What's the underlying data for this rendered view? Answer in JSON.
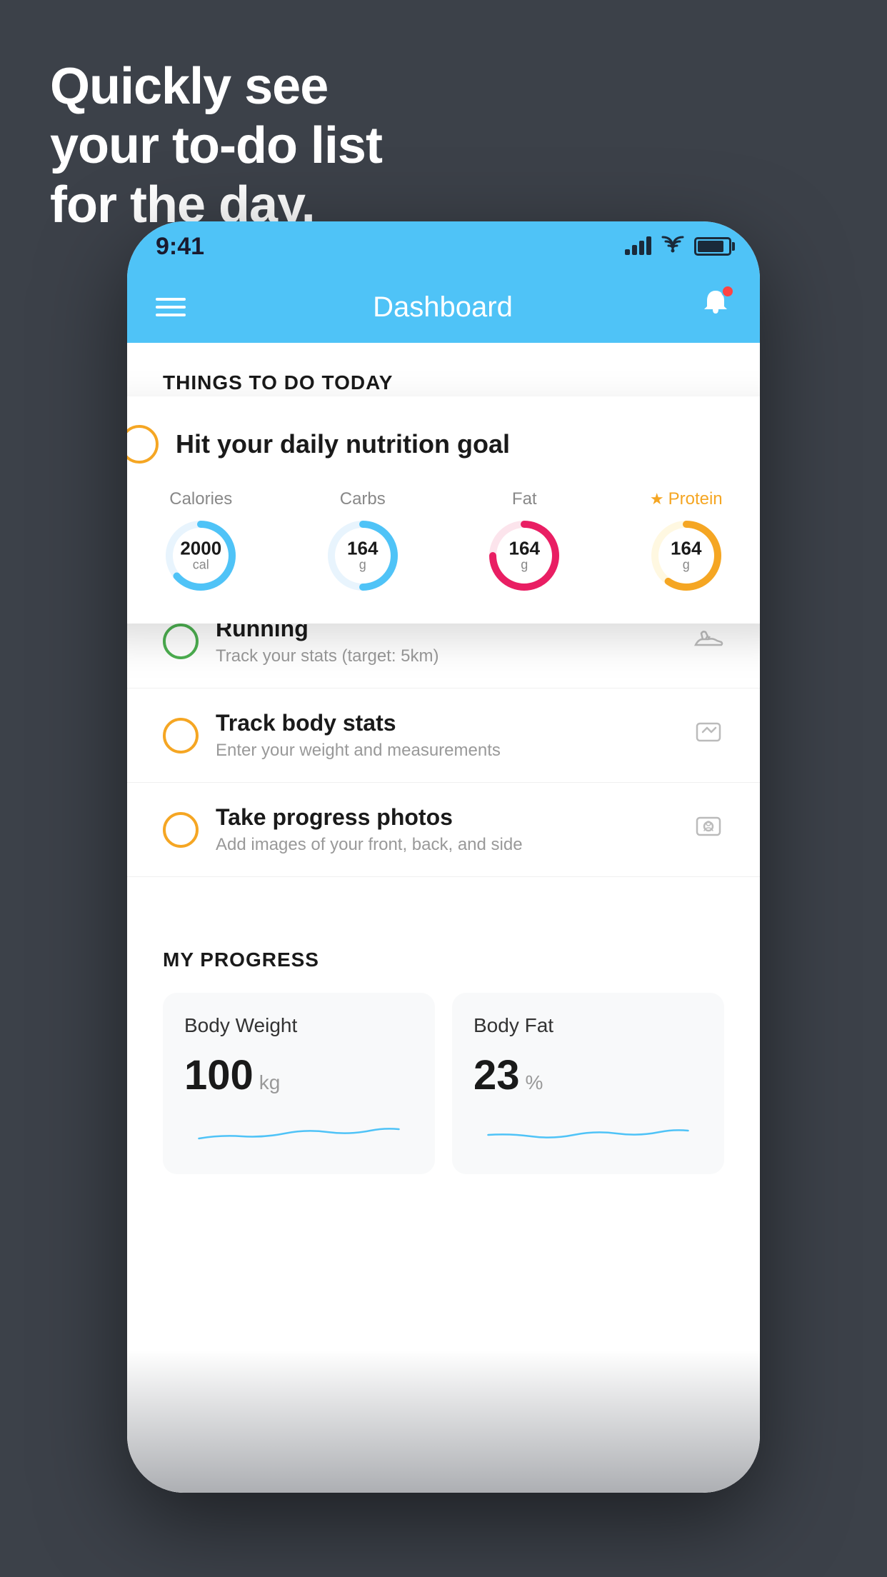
{
  "page": {
    "background_color": "#3c4149"
  },
  "headline": {
    "line1": "Quickly see",
    "line2": "your to-do list",
    "line3": "for the day."
  },
  "status_bar": {
    "time": "9:41",
    "background_color": "#4fc3f7"
  },
  "header": {
    "title": "Dashboard",
    "background_color": "#4fc3f7"
  },
  "section_things_to_do": {
    "label": "THINGS TO DO TODAY"
  },
  "floating_card": {
    "check_color": "#f5a623",
    "title": "Hit your daily nutrition goal",
    "items": [
      {
        "label": "Calories",
        "value": "2000",
        "unit": "cal",
        "color": "#4fc3f7",
        "progress": 0.65
      },
      {
        "label": "Carbs",
        "value": "164",
        "unit": "g",
        "color": "#4fc3f7",
        "progress": 0.5
      },
      {
        "label": "Fat",
        "value": "164",
        "unit": "g",
        "color": "#e91e63",
        "progress": 0.75
      },
      {
        "label": "Protein",
        "value": "164",
        "unit": "g",
        "color": "#f5a623",
        "progress": 0.6,
        "starred": true
      }
    ]
  },
  "todo_items": [
    {
      "circle_color": "#4caf50",
      "title": "Running",
      "subtitle": "Track your stats (target: 5km)",
      "icon": "shoe"
    },
    {
      "circle_color": "#f5a623",
      "title": "Track body stats",
      "subtitle": "Enter your weight and measurements",
      "icon": "scale"
    },
    {
      "circle_color": "#f5a623",
      "title": "Take progress photos",
      "subtitle": "Add images of your front, back, and side",
      "icon": "person"
    }
  ],
  "progress_section": {
    "title": "MY PROGRESS",
    "cards": [
      {
        "title": "Body Weight",
        "value": "100",
        "unit": "kg"
      },
      {
        "title": "Body Fat",
        "value": "23",
        "unit": "%"
      }
    ]
  }
}
